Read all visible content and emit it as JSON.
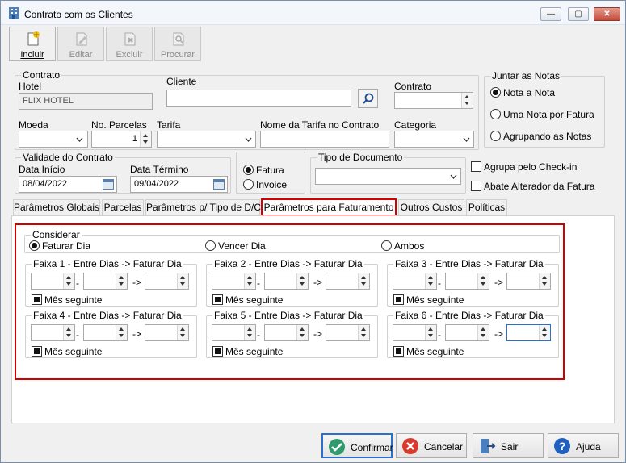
{
  "window": {
    "title": "Contrato com os Clientes",
    "min_icon": "minimize-icon",
    "max_icon": "maximize-icon",
    "close_icon": "close-icon"
  },
  "toolbar": [
    {
      "label": "Incluir",
      "icon": "add-document-icon",
      "enabled": true
    },
    {
      "label": "Editar",
      "icon": "edit-document-icon",
      "enabled": false
    },
    {
      "label": "Excluir",
      "icon": "delete-document-icon",
      "enabled": false
    },
    {
      "label": "Procurar",
      "icon": "search-document-icon",
      "enabled": false
    }
  ],
  "contrato": {
    "group_label": "Contrato",
    "hotel_label": "Hotel",
    "hotel_value": "FLIX HOTEL",
    "cliente_label": "Cliente",
    "cliente_value": "",
    "contrato_label": "Contrato",
    "contrato_value": "",
    "moeda_label": "Moeda",
    "moeda_value": "",
    "parcelas_label": "No. Parcelas",
    "parcelas_value": "1",
    "tarifa_label": "Tarifa",
    "tarifa_value": "",
    "nome_tarifa_label": "Nome da Tarifa no Contrato",
    "nome_tarifa_value": "",
    "categoria_label": "Categoria",
    "categoria_value": ""
  },
  "juntar": {
    "group_label": "Juntar as Notas",
    "options": [
      "Nota a Nota",
      "Uma Nota por Fatura",
      "Agrupando as Notas"
    ],
    "selected": 0
  },
  "validade": {
    "group_label": "Validade do Contrato",
    "inicio_label": "Data Início",
    "inicio_value": "08/04/2022",
    "termino_label": "Data Término",
    "termino_value": "09/04/2022"
  },
  "fatura_invoice": {
    "options": [
      "Fatura",
      "Invoice"
    ],
    "selected": 0
  },
  "tipo_documento": {
    "label": "Tipo de Documento",
    "value": ""
  },
  "checks": {
    "agrupa_label": "Agrupa pelo Check-in",
    "agrupa_checked": false,
    "abate_label": "Abate Alterador da Fatura",
    "abate_checked": false
  },
  "tabs": [
    "Parâmetros Globais",
    "Parcelas",
    "Parâmetros p/ Tipo de D/C",
    "Parâmetros para Faturamento",
    "Outros Custos",
    "Políticas"
  ],
  "active_tab": 3,
  "considerar": {
    "group_label": "Considerar",
    "options": [
      "Faturar Dia",
      "Vencer Dia",
      "Ambos"
    ],
    "selected": 0
  },
  "faixas": [
    {
      "label": "Faixa 1 - Entre Dias -> Faturar Dia",
      "sep": "-",
      "arrow": "->",
      "mes_label": "Mês seguinte"
    },
    {
      "label": "Faixa 2 - Entre Dias -> Faturar Dia",
      "sep": "-",
      "arrow": "->",
      "mes_label": "Mês seguinte"
    },
    {
      "label": "Faixa 3 - Entre Dias -> Faturar Dia",
      "sep": "-",
      "arrow": "->",
      "mes_label": "Mês seguinte"
    },
    {
      "label": "Faixa 4 - Entre Dias -> Faturar Dia",
      "sep": "-",
      "arrow": "->",
      "mes_label": "Mês seguinte"
    },
    {
      "label": "Faixa 5 - Entre Dias -> Faturar Dia",
      "sep": "-",
      "arrow": "->",
      "mes_label": "Mês seguinte"
    },
    {
      "label": "Faixa 6 - Entre Dias -> Faturar Dia",
      "sep": "-",
      "arrow": "->",
      "mes_label": "Mês seguinte"
    }
  ],
  "buttons": {
    "confirmar": "Confirmar",
    "cancelar": "Cancelar",
    "sair": "Sair",
    "ajuda": "Ajuda"
  },
  "colors": {
    "highlight_red": "#d40000",
    "focus_blue": "#2a6fc9"
  }
}
